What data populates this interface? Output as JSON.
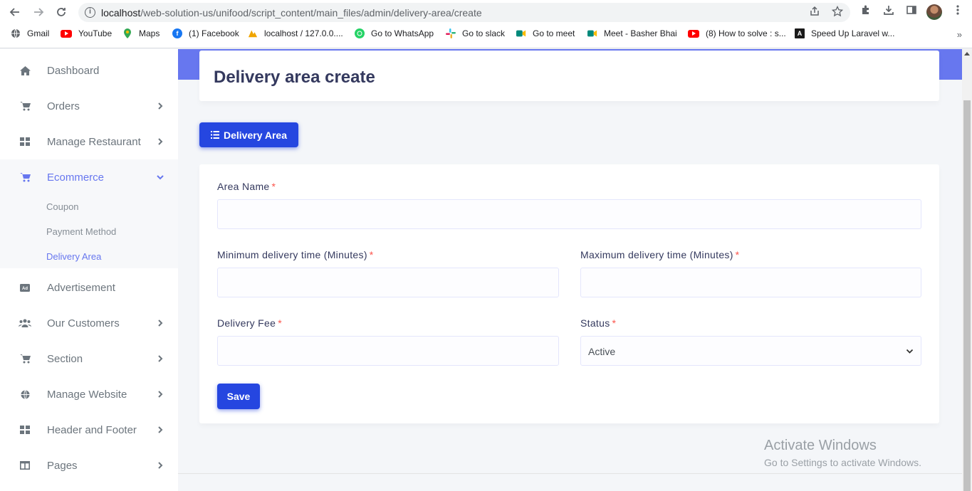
{
  "browser": {
    "url_host": "localhost",
    "url_path": "/web-solution-us/unifood/script_content/main_files/admin/delivery-area/create",
    "bookmarks": [
      {
        "label": "Gmail",
        "icon": "globe-icon",
        "color": "#5f6368"
      },
      {
        "label": "YouTube",
        "icon": "youtube-icon",
        "color": "#ff0000"
      },
      {
        "label": "Maps",
        "icon": "maps-pin-icon",
        "color": "#34a853"
      },
      {
        "label": "(1) Facebook",
        "icon": "facebook-icon",
        "color": "#1877f2"
      },
      {
        "label": "localhost / 127.0.0....",
        "icon": "phpmyadmin-icon",
        "color": "#f0a500"
      },
      {
        "label": "Go to WhatsApp",
        "icon": "whatsapp-icon",
        "color": "#25d366"
      },
      {
        "label": "Go to slack",
        "icon": "slack-icon",
        "color": "#e01e5a"
      },
      {
        "label": "Go to meet",
        "icon": "meet-icon",
        "color": "#00897b"
      },
      {
        "label": "Meet - Basher Bhai",
        "icon": "meet-icon",
        "color": "#00897b"
      },
      {
        "label": "(8) How to solve : s...",
        "icon": "youtube-icon",
        "color": "#ff0000"
      },
      {
        "label": "Speed Up Laravel w...",
        "icon": "laravel-icon",
        "color": "#1a1a1a"
      }
    ],
    "more_bookmarks": "»"
  },
  "sidebar": {
    "items": [
      {
        "label": "Dashboard",
        "icon": "home-icon"
      },
      {
        "label": "Orders",
        "icon": "cart-icon"
      },
      {
        "label": "Manage Restaurant",
        "icon": "grid-icon"
      },
      {
        "label": "Ecommerce",
        "icon": "cart-icon"
      },
      {
        "label": "Advertisement",
        "icon": "ad-icon"
      },
      {
        "label": "Our Customers",
        "icon": "users-icon"
      },
      {
        "label": "Section",
        "icon": "cart-icon"
      },
      {
        "label": "Manage Website",
        "icon": "globe-icon"
      },
      {
        "label": "Header and Footer",
        "icon": "grid-icon"
      },
      {
        "label": "Pages",
        "icon": "columns-icon"
      }
    ],
    "ecommerce_sub": [
      {
        "label": "Coupon"
      },
      {
        "label": "Payment Method"
      },
      {
        "label": "Delivery Area"
      }
    ]
  },
  "main": {
    "page_title": "Delivery area create",
    "list_button": "Delivery Area",
    "form": {
      "area_name_label": "Area Name",
      "min_time_label": "Minimum delivery time (Minutes)",
      "max_time_label": "Maximum delivery time (Minutes)",
      "fee_label": "Delivery Fee",
      "status_label": "Status",
      "required_mark": "*",
      "status_value": "Active",
      "save_label": "Save"
    }
  },
  "watermark": {
    "line1": "Activate Windows",
    "line2": "Go to Settings to activate Windows."
  },
  "colors": {
    "accent": "#6777ef",
    "primary_button": "#2546e0",
    "required": "#fc544b"
  }
}
